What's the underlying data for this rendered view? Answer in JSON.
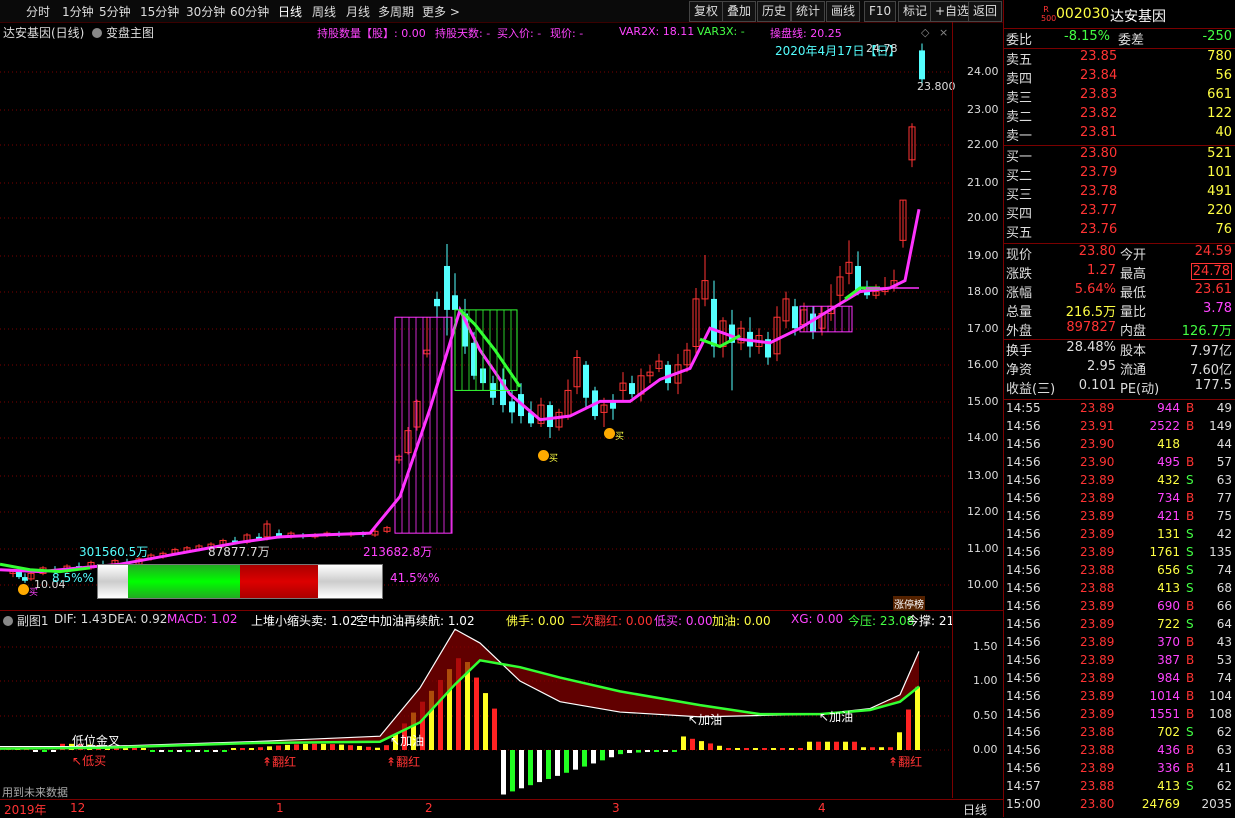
{
  "toolbar": {
    "periods": [
      "分时",
      "1分钟",
      "5分钟",
      "15分钟",
      "30分钟",
      "60分钟",
      "日线",
      "周线",
      "月线",
      "多周期",
      "更多"
    ],
    "more_arrow": ">",
    "buttons": [
      "复权",
      "叠加",
      "历史",
      "统计",
      "画线",
      "F10",
      "标记",
      "+自选",
      "返回"
    ]
  },
  "chart": {
    "title": "达安基因(日线)",
    "variant_label": "变盘主图",
    "header_items": [
      {
        "text": "持股数量【股】: 0.00",
        "color": "#ff44ff"
      },
      {
        "text": "持股天数: -",
        "color": "#ff44ff"
      },
      {
        "text": "买入价: -",
        "color": "#ff44ff"
      },
      {
        "text": "现价: -",
        "color": "#ff44ff"
      },
      {
        "text": "VAR2X: 18.11",
        "color": "#ff44ff"
      },
      {
        "text": "VAR3X: -",
        "color": "#44ff44"
      },
      {
        "text": "操盘线: 20.25",
        "color": "#ff44ff"
      }
    ],
    "date_label": "2020年4月17日【日】",
    "high_label": "24.78",
    "last_label": "23.800",
    "low_label": "10.04",
    "y_ticks": [
      "24.00",
      "23.00",
      "22.00",
      "21.00",
      "20.00",
      "19.00",
      "18.00",
      "17.00",
      "16.00",
      "15.00",
      "14.00",
      "13.00",
      "12.00",
      "11.00",
      "10.00"
    ],
    "volume_labels": [
      "301560.5万",
      "87877.7万",
      "213682.8万"
    ],
    "pct_left": "8.5%%",
    "pct_right": "41.5%%",
    "buy_marks": [
      "买",
      "买",
      "买",
      "买"
    ],
    "corner_label": "涨停榜"
  },
  "sub": {
    "name": "副图1",
    "items": [
      {
        "text": "DIF: 1.43",
        "color": "#dddddd"
      },
      {
        "text": "DEA: 0.92",
        "color": "#dddddd"
      },
      {
        "text": "MACD: 1.02",
        "color": "#ff44ff"
      },
      {
        "text": "上堆小缩头卖: 1.02",
        "color": "#ffffff"
      },
      {
        "text": "空中加油再续航: 1.02",
        "color": "#ffffff"
      },
      {
        "text": "佛手: 0.00",
        "color": "#ffff44"
      },
      {
        "text": "二次翻红: 0.00",
        "color": "#ff3333"
      },
      {
        "text": "低买: 0.00",
        "color": "#ff44ff"
      },
      {
        "text": "加油: 0.00",
        "color": "#ffff44"
      },
      {
        "text": "XG: 0.00",
        "color": "#ff44ff"
      },
      {
        "text": "今压: 23.08",
        "color": "#44ff44"
      },
      {
        "text": "今撑: 21",
        "color": "#ffffff"
      }
    ],
    "y_ticks": [
      "1.50",
      "1.00",
      "0.50",
      "0.00"
    ],
    "annotations": {
      "gold_cross": "低位金叉",
      "low_buy": "低买",
      "jiayou": "加油",
      "fanhong": "翻红"
    },
    "footer_note": "用到未来数据"
  },
  "xaxis": {
    "labels": [
      "2019年",
      "12",
      "1",
      "2",
      "3",
      "4"
    ],
    "period_button": "日线"
  },
  "quote": {
    "logo": "R 500",
    "code": "002030",
    "name": "达安基因",
    "weibi_label": "委比",
    "weibi": "-8.15%",
    "weicha_label": "委差",
    "weicha": "-250",
    "sells": [
      {
        "label": "卖五",
        "price": "23.85",
        "vol": "780"
      },
      {
        "label": "卖四",
        "price": "23.84",
        "vol": "56"
      },
      {
        "label": "卖三",
        "price": "23.83",
        "vol": "661"
      },
      {
        "label": "卖二",
        "price": "23.82",
        "vol": "122"
      },
      {
        "label": "卖一",
        "price": "23.81",
        "vol": "40"
      }
    ],
    "buys": [
      {
        "label": "买一",
        "price": "23.80",
        "vol": "521"
      },
      {
        "label": "买二",
        "price": "23.79",
        "vol": "101"
      },
      {
        "label": "买三",
        "price": "23.78",
        "vol": "491"
      },
      {
        "label": "买四",
        "price": "23.77",
        "vol": "220"
      },
      {
        "label": "买五",
        "price": "23.76",
        "vol": "76"
      }
    ],
    "stats": [
      {
        "l1": "现价",
        "v1": "23.80",
        "c1": "#ff3333",
        "l2": "今开",
        "v2": "24.59",
        "c2": "#ff3333"
      },
      {
        "l1": "涨跌",
        "v1": "1.27",
        "c1": "#ff3333",
        "l2": "最高",
        "v2": "24.78",
        "c2": "#ff3333"
      },
      {
        "l1": "涨幅",
        "v1": "5.64%",
        "c1": "#ff3333",
        "l2": "最低",
        "v2": "23.61",
        "c2": "#ff3333"
      },
      {
        "l1": "总量",
        "v1": "216.5万",
        "c1": "#ffff44",
        "l2": "量比",
        "v2": "3.78",
        "c2": "#ff44ff"
      },
      {
        "l1": "外盘",
        "v1": "897827",
        "c1": "#ff3333",
        "l2": "内盘",
        "v2": "126.7万",
        "c2": "#44ff44"
      }
    ],
    "stats2": [
      {
        "l1": "换手",
        "v1": "28.48%",
        "l2": "股本",
        "v2": "7.97亿"
      },
      {
        "l1": "净资",
        "v1": "2.95",
        "l2": "流通",
        "v2": "7.60亿"
      },
      {
        "l1": "收益(三)",
        "v1": "0.101",
        "l2": "PE(动)",
        "v2": "177.5"
      }
    ],
    "ticks": [
      {
        "t": "14:55",
        "p": "23.89",
        "v": "944",
        "s": "B",
        "n": "49"
      },
      {
        "t": "14:56",
        "p": "23.91",
        "v": "2522",
        "s": "B",
        "n": "149"
      },
      {
        "t": "14:56",
        "p": "23.90",
        "v": "418",
        "s": "",
        "n": "44"
      },
      {
        "t": "14:56",
        "p": "23.90",
        "v": "495",
        "s": "B",
        "n": "57"
      },
      {
        "t": "14:56",
        "p": "23.89",
        "v": "432",
        "s": "S",
        "n": "63"
      },
      {
        "t": "14:56",
        "p": "23.89",
        "v": "734",
        "s": "B",
        "n": "77"
      },
      {
        "t": "14:56",
        "p": "23.89",
        "v": "421",
        "s": "B",
        "n": "75"
      },
      {
        "t": "14:56",
        "p": "23.89",
        "v": "131",
        "s": "S",
        "n": "42"
      },
      {
        "t": "14:56",
        "p": "23.89",
        "v": "1761",
        "s": "S",
        "n": "135"
      },
      {
        "t": "14:56",
        "p": "23.88",
        "v": "656",
        "s": "S",
        "n": "74"
      },
      {
        "t": "14:56",
        "p": "23.88",
        "v": "413",
        "s": "S",
        "n": "68"
      },
      {
        "t": "14:56",
        "p": "23.89",
        "v": "690",
        "s": "B",
        "n": "66"
      },
      {
        "t": "14:56",
        "p": "23.89",
        "v": "722",
        "s": "S",
        "n": "64"
      },
      {
        "t": "14:56",
        "p": "23.89",
        "v": "370",
        "s": "B",
        "n": "43"
      },
      {
        "t": "14:56",
        "p": "23.89",
        "v": "387",
        "s": "B",
        "n": "53"
      },
      {
        "t": "14:56",
        "p": "23.89",
        "v": "984",
        "s": "B",
        "n": "74"
      },
      {
        "t": "14:56",
        "p": "23.89",
        "v": "1014",
        "s": "B",
        "n": "104"
      },
      {
        "t": "14:56",
        "p": "23.89",
        "v": "1551",
        "s": "B",
        "n": "108"
      },
      {
        "t": "14:56",
        "p": "23.88",
        "v": "702",
        "s": "S",
        "n": "62"
      },
      {
        "t": "14:56",
        "p": "23.88",
        "v": "436",
        "s": "B",
        "n": "63"
      },
      {
        "t": "14:56",
        "p": "23.89",
        "v": "336",
        "s": "B",
        "n": "41"
      },
      {
        "t": "14:57",
        "p": "23.88",
        "v": "413",
        "s": "S",
        "n": "62"
      },
      {
        "t": "15:00",
        "p": "23.80",
        "v": "24769",
        "s": "",
        "n": "2035"
      }
    ]
  },
  "colors": {
    "up": "#ff3333",
    "down": "#54ffff",
    "buy": "#ff3333",
    "sell": "#44ff44",
    "purple": "#ff44ff",
    "yellow": "#ffff44",
    "line_magenta": "#ff33ff",
    "line_green": "#33ff33"
  }
}
